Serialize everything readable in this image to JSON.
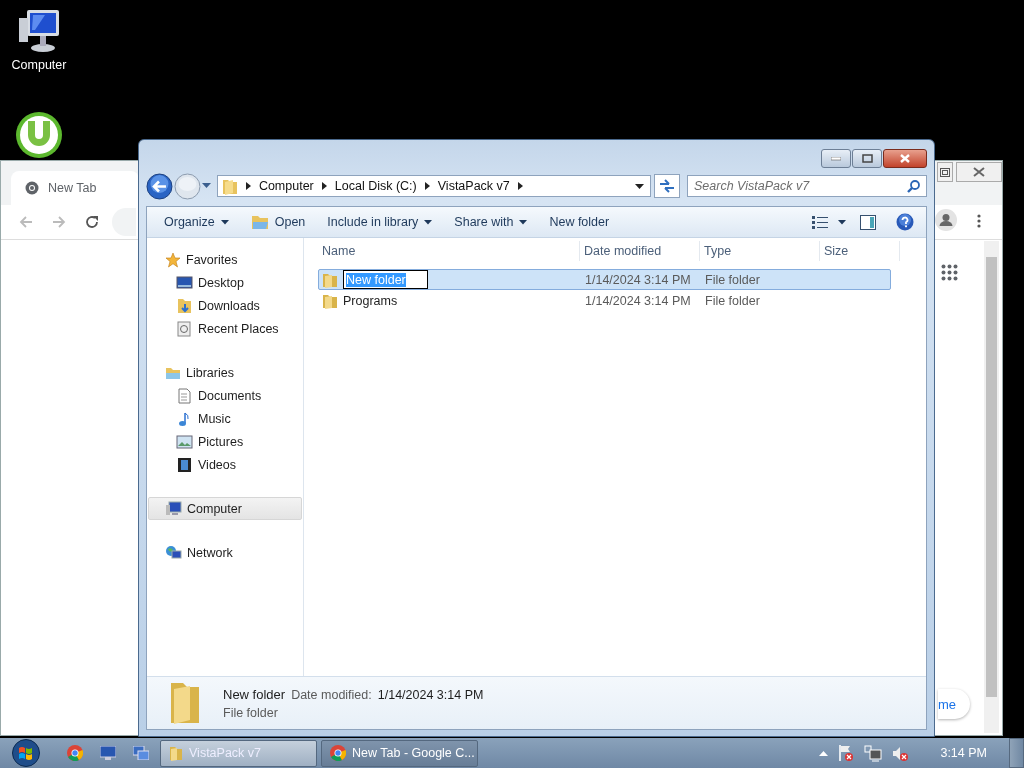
{
  "desktop": {
    "icons": [
      {
        "label": "Computer"
      }
    ]
  },
  "browser_window": {
    "tab": {
      "label": "New Tab"
    },
    "side_button": "me"
  },
  "explorer": {
    "breadcrumb": [
      "Computer",
      "Local Disk (C:)",
      "VistaPack v7"
    ],
    "search": {
      "placeholder": "Search VistaPack v7"
    },
    "toolbar": [
      {
        "label": "Organize",
        "kind": "menu"
      },
      {
        "label": "Open",
        "kind": "icon"
      },
      {
        "label": "Include in library",
        "kind": "menu"
      },
      {
        "label": "Share with",
        "kind": "menu"
      },
      {
        "label": "New folder",
        "kind": "plain"
      }
    ],
    "nav": [
      {
        "label": "Favorites",
        "selected": false,
        "children": [
          {
            "label": "Desktop",
            "selected": false
          },
          {
            "label": "Downloads",
            "selected": false
          },
          {
            "label": "Recent Places",
            "selected": false
          }
        ]
      },
      {
        "label": "Libraries",
        "selected": false,
        "children": [
          {
            "label": "Documents",
            "selected": false
          },
          {
            "label": "Music",
            "selected": false
          },
          {
            "label": "Pictures",
            "selected": false
          },
          {
            "label": "Videos",
            "selected": false
          }
        ]
      },
      {
        "label": "Computer",
        "selected": true
      },
      {
        "label": "Network",
        "selected": false
      }
    ],
    "columns": [
      "Name",
      "Date modified",
      "Type",
      "Size"
    ],
    "rows": [
      {
        "name": "New folder",
        "date": "1/14/2024 3:14 PM",
        "type": "File folder",
        "selected": true,
        "renaming": true
      },
      {
        "name": "Programs",
        "date": "1/14/2024 3:14 PM",
        "type": "File folder",
        "selected": false,
        "renaming": false
      }
    ],
    "details": {
      "name": "New folder",
      "date_label": "Date modified:",
      "date": "1/14/2024 3:14 PM",
      "type": "File folder"
    }
  },
  "taskbar": {
    "tasks": [
      {
        "label": "VistaPack v7",
        "selected": true
      },
      {
        "label": "New Tab - Google C...",
        "selected": false
      }
    ],
    "clock": "3:14 PM"
  }
}
